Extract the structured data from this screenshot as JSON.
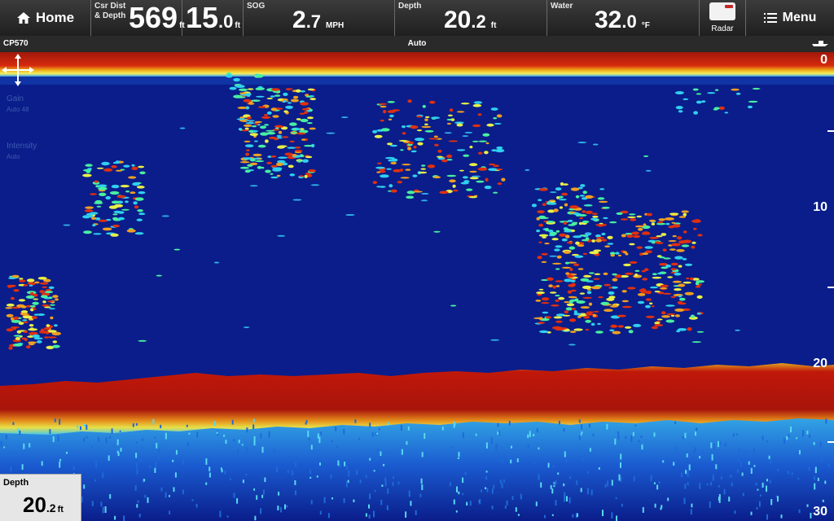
{
  "topbar": {
    "home_label": "Home",
    "csr_label_line1": "Csr Dist",
    "csr_label_line2": "& Depth",
    "csr_dist_value": "569",
    "csr_dist_unit": "ft",
    "csr_depth_int": "15",
    "csr_depth_dec": ".0",
    "csr_depth_unit": "ft",
    "sog_label": "SOG",
    "sog_int": "2",
    "sog_dec": ".7",
    "sog_unit": "MPH",
    "depth_label": "Depth",
    "depth_int": "20",
    "depth_dec": ".2",
    "depth_unit": "ft",
    "water_label": "Water",
    "water_int": "32",
    "water_dec": ".0",
    "water_unit": "°F",
    "radar_label": "Radar",
    "menu_label": "Menu"
  },
  "status": {
    "device": "CP570",
    "mode": "Auto"
  },
  "overlay": {
    "gain_label": "Gain",
    "gain_sub": "Auto 48",
    "intensity_label": "Intensity",
    "intensity_sub": "Auto"
  },
  "depth_scale": {
    "ticks": [
      "0",
      "10",
      "20",
      "30"
    ]
  },
  "depth_box": {
    "label": "Depth",
    "int": "20",
    "dec": ".2",
    "unit": "ft"
  },
  "colors": {
    "water": "#0a1d8a",
    "bottom": "#b51a0a",
    "surface": "#c8200e"
  }
}
